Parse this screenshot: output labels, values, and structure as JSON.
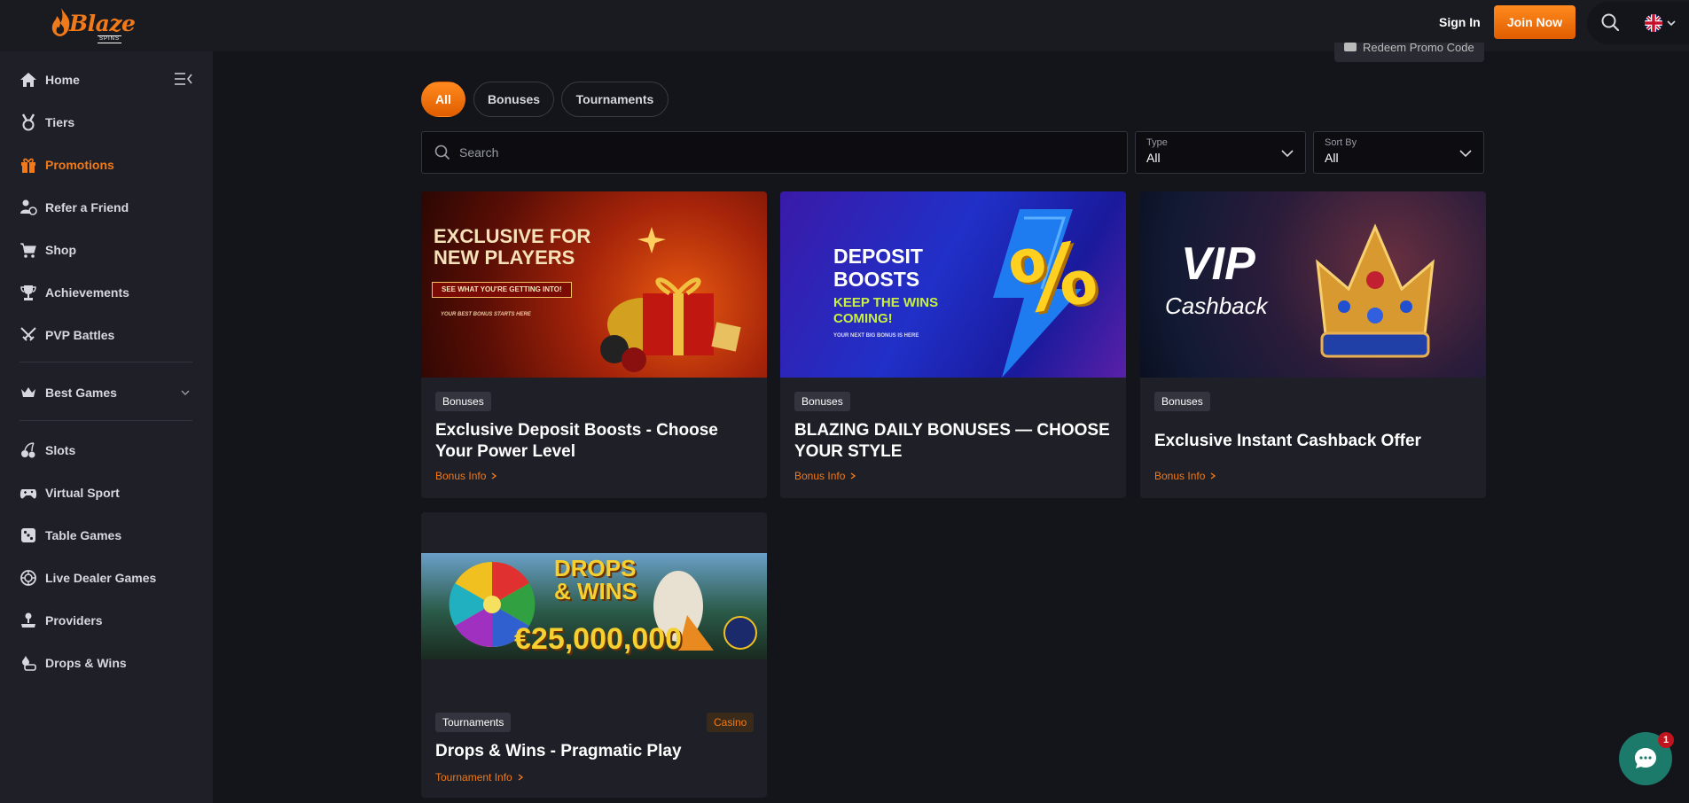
{
  "header": {
    "logo_text": "Blaze",
    "logo_sub": "SPINS",
    "sign_in": "Sign In",
    "join_now": "Join Now"
  },
  "sidebar": {
    "items": [
      {
        "label": "Home",
        "icon": "home-icon"
      },
      {
        "label": "Tiers",
        "icon": "medal-icon"
      },
      {
        "label": "Promotions",
        "icon": "gift-icon",
        "active": true
      },
      {
        "label": "Refer a Friend",
        "icon": "users-icon"
      },
      {
        "label": "Shop",
        "icon": "cart-icon"
      },
      {
        "label": "Achievements",
        "icon": "trophy-icon"
      },
      {
        "label": "PVP Battles",
        "icon": "swords-icon"
      },
      {
        "label": "Best Games",
        "icon": "crown-icon"
      },
      {
        "label": "Slots",
        "icon": "cherries-icon"
      },
      {
        "label": "Virtual Sport",
        "icon": "gamepad-icon"
      },
      {
        "label": "Table Games",
        "icon": "dice-icon"
      },
      {
        "label": "Live Dealer Games",
        "icon": "roulette-icon"
      },
      {
        "label": "Providers",
        "icon": "joystick-icon"
      },
      {
        "label": "Drops & Wins",
        "icon": "drops-icon"
      }
    ]
  },
  "main": {
    "redeem_label": "Redeem Promo Code",
    "tabs": [
      {
        "label": "All",
        "active": true
      },
      {
        "label": "Bonuses"
      },
      {
        "label": "Tournaments"
      }
    ],
    "search": {
      "placeholder": "Search"
    },
    "type_filter": {
      "label": "Type",
      "value": "All"
    },
    "sort_filter": {
      "label": "Sort By",
      "value": "All"
    },
    "cards": [
      {
        "badge": "Bonuses",
        "title": "Exclusive Deposit Boosts - Choose Your Power Level",
        "link": "Bonus Info",
        "image": {
          "line1": "EXCLUSIVE FOR",
          "line2": "NEW PLAYERS",
          "cta": "SEE WHAT YOU'RE GETTING INTO!",
          "tagline": "YOUR BEST BONUS STARTS HERE"
        }
      },
      {
        "badge": "Bonuses",
        "title": "BLAZING DAILY BONUSES — CHOOSE YOUR STYLE",
        "link": "Bonus Info",
        "image": {
          "line1": "DEPOSIT",
          "line2": "BOOSTS",
          "line3": "KEEP THE WINS",
          "line4": "COMING!",
          "tagline": "YOUR NEXT BIG BONUS IS HERE",
          "symbol": "%"
        }
      },
      {
        "badge": "Bonuses",
        "title": "Exclusive Instant Cashback Offer",
        "link": "Bonus Info",
        "image": {
          "line1": "VIP",
          "line2": "Cashback"
        }
      },
      {
        "badge": "Tournaments",
        "badge2": "Casino",
        "title": "Drops & Wins - Pragmatic Play",
        "link": "Tournament Info",
        "image": {
          "line1": "DROPS",
          "line2": "& WINS",
          "amount": "€25,000,000"
        }
      }
    ]
  },
  "chat": {
    "count": "1"
  },
  "colors": {
    "accent": "#f07a1a",
    "bg": "#14141b",
    "sidebar": "#1f1f27",
    "card": "#1f1f27",
    "chat": "#1b7a6a"
  }
}
